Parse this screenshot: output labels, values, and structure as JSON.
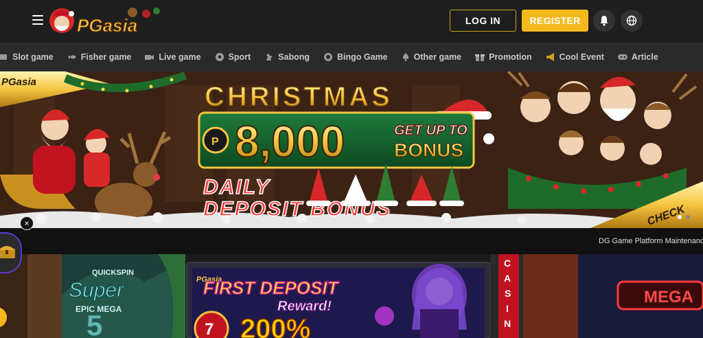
{
  "header": {
    "logo_text": "PGasia",
    "login_label": "LOG IN",
    "register_label": "REGISTER",
    "accent_color": "#f5b91c"
  },
  "nav": {
    "items": [
      {
        "label": "Slot game",
        "icon": "slot-icon"
      },
      {
        "label": "Fisher game",
        "icon": "fish-icon"
      },
      {
        "label": "Live game",
        "icon": "camera-icon"
      },
      {
        "label": "Sport",
        "icon": "soccer-ball-icon"
      },
      {
        "label": "Sabong",
        "icon": "rooster-icon"
      },
      {
        "label": "Bingo Game",
        "icon": "bingo-ball-icon"
      },
      {
        "label": "Other game",
        "icon": "spade-icon"
      },
      {
        "label": "Promotion",
        "icon": "gift-icon"
      },
      {
        "label": "Cool Event",
        "icon": "megaphone-icon"
      },
      {
        "label": "Article",
        "icon": "gamepad-icon"
      }
    ]
  },
  "banner": {
    "corner_brand": "PGasia",
    "title": "CHRISTMAS",
    "amount": "8,000",
    "get_up_to": "GET UP TO",
    "bonus": "BONUS",
    "line1": "DAILY",
    "line2": "DEPOSIT BONUS",
    "check": "CHECK"
  },
  "marquee": {
    "text": "DG Game Platform Maintenance N"
  },
  "promo_cards": {
    "left_badge": "QUICKSPIN",
    "left_title": "Super",
    "left_sub": "EPIC MEGA",
    "center_brand": "PGasia",
    "center_title": "FIRST DEPOSIT",
    "center_reward": "Reward!",
    "center_percent": "200%",
    "right_sign": "CASINO",
    "right_mega": "MEGA"
  }
}
